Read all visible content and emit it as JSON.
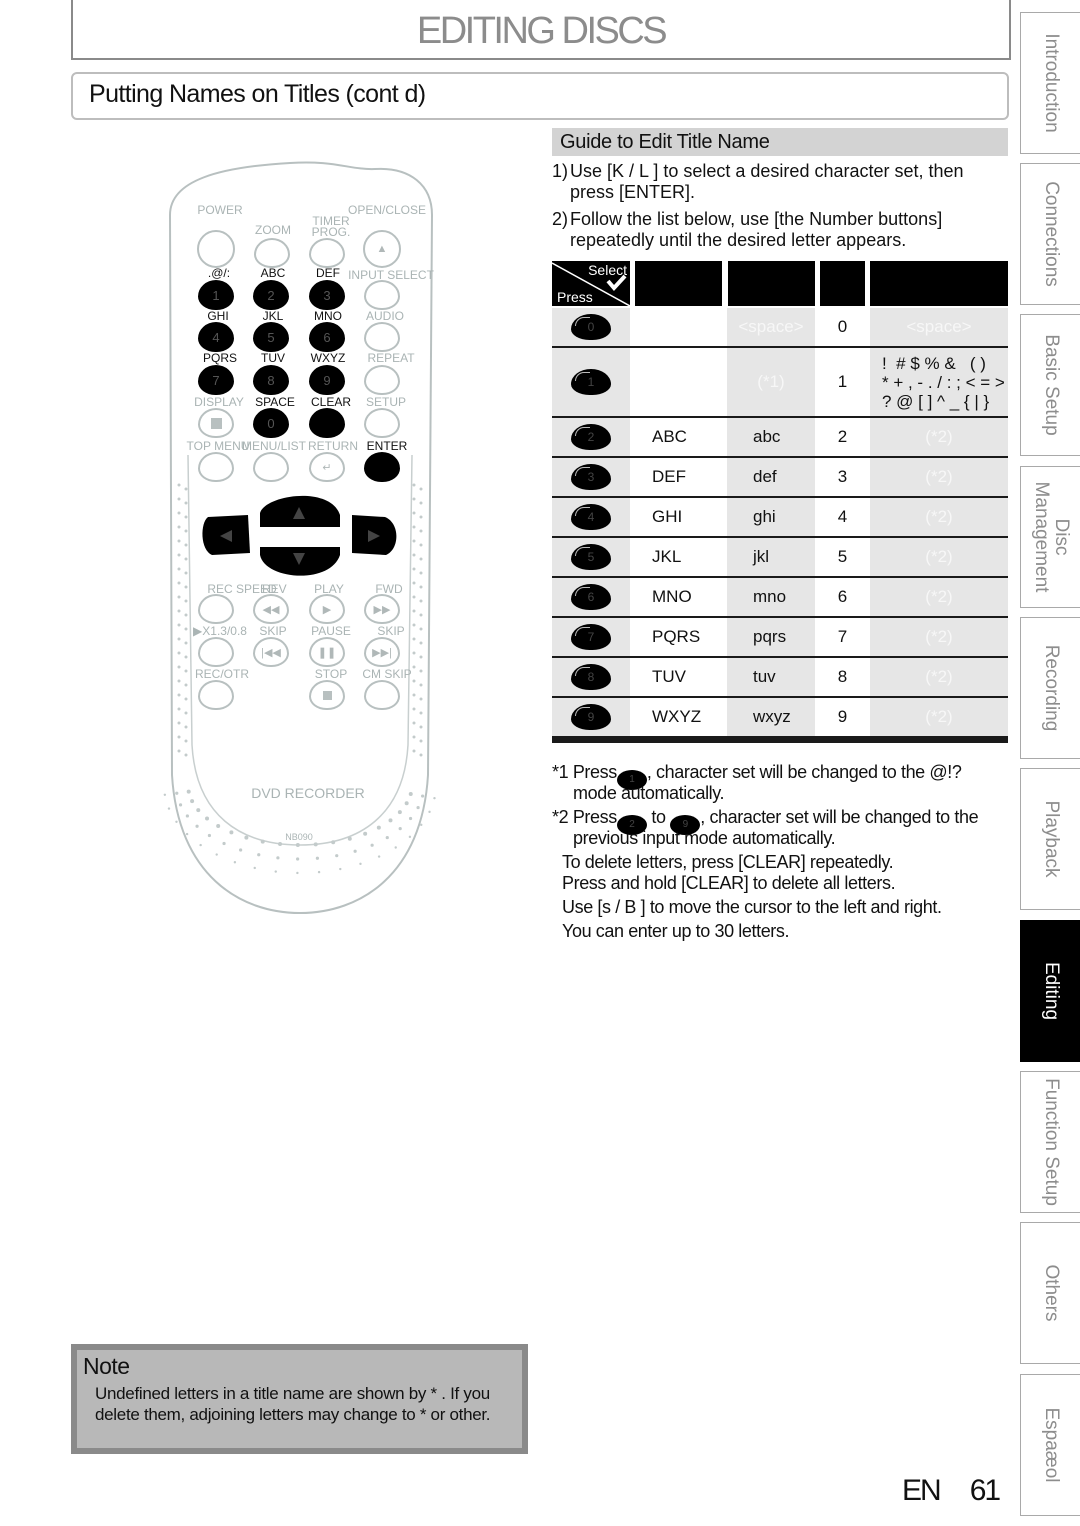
{
  "header": {
    "title": "EDITING DISCS",
    "subtitle": "Putting Names on Titles (cont d)"
  },
  "side_tabs": [
    {
      "label": "Introduction",
      "active": false
    },
    {
      "label": "Connections",
      "active": false
    },
    {
      "label": "Basic Setup",
      "active": false
    },
    {
      "label": "Disc\nManagement",
      "label_line1": "Disc",
      "label_line2": "Management",
      "active": false
    },
    {
      "label": "Recording",
      "active": false
    },
    {
      "label": "Playback",
      "active": false
    },
    {
      "label": "Editing",
      "active": true
    },
    {
      "label": "Function Setup",
      "active": false
    },
    {
      "label": "Others",
      "active": false
    },
    {
      "label": "Espaæol",
      "active": false
    }
  ],
  "guide": {
    "heading": "Guide to Edit Title Name",
    "steps": [
      {
        "num": "1)",
        "text": "Use [K / L ] to select a desired character set, then press [ENTER]."
      },
      {
        "num": "2)",
        "text": "Follow the list below, use [the Number buttons] repeatedly until the desired letter appears."
      }
    ]
  },
  "char_table": {
    "corner_select": "Select",
    "corner_press": "Press",
    "rows": [
      {
        "button": "0",
        "upper": "",
        "lower": "<space>",
        "number": "0",
        "symbol": "<space>"
      },
      {
        "button": "1",
        "upper": "",
        "lower": "(*1)",
        "number": "1",
        "symbol": "!  # $ % &   ( )\n* + , - . / : ; < = >\n? @ [ ] ^ _ { | }"
      },
      {
        "button": "2",
        "upper": "ABC",
        "lower": "abc",
        "number": "2",
        "symbol": "(*2)"
      },
      {
        "button": "3",
        "upper": "DEF",
        "lower": "def",
        "number": "3",
        "symbol": "(*2)"
      },
      {
        "button": "4",
        "upper": "GHI",
        "lower": "ghi",
        "number": "4",
        "symbol": "(*2)"
      },
      {
        "button": "5",
        "upper": "JKL",
        "lower": "jkl",
        "number": "5",
        "symbol": "(*2)"
      },
      {
        "button": "6",
        "upper": "MNO",
        "lower": "mno",
        "number": "6",
        "symbol": "(*2)"
      },
      {
        "button": "7",
        "upper": "PQRS",
        "lower": "pqrs",
        "number": "7",
        "symbol": "(*2)"
      },
      {
        "button": "8",
        "upper": "TUV",
        "lower": "tuv",
        "number": "8",
        "symbol": "(*2)"
      },
      {
        "button": "9",
        "upper": "WXYZ",
        "lower": "wxyz",
        "number": "9",
        "symbol": "(*2)"
      }
    ]
  },
  "footnotes": {
    "fn1_a": "*1 Press",
    "fn1_btn": "1",
    "fn1_b": ", character set will be changed to the   @!?",
    "fn1_c": "mode automatically.",
    "fn2_a": "*2 Press",
    "fn2_btn1": "2",
    "fn2_to": " to ",
    "fn2_btn2": "9",
    "fn2_b": ", character set will be changed to the",
    "fn2_c": "previous input mode automatically.",
    "tips": [
      "To delete letters, press [CLEAR] repeatedly.",
      "Press and hold [CLEAR] to delete all letters.",
      "Use [s   / B ] to move the cursor to the left and right.",
      "You can enter up to 30 letters."
    ]
  },
  "remote": {
    "labels": {
      "power": "POWER",
      "zoom": "ZOOM",
      "timer": "TIMER",
      "prog": "PROG.",
      "open_close": "OPEN/CLOSE",
      "k1": ".@/:",
      "k2": "ABC",
      "k3": "DEF",
      "input_select": "INPUT SELECT",
      "k4": "GHI",
      "k5": "JKL",
      "k6": "MNO",
      "audio": "AUDIO",
      "k7": "PQRS",
      "k8": "TUV",
      "k9": "WXYZ",
      "repeat": "REPEAT",
      "display": "DISPLAY",
      "space": "SPACE",
      "clear": "CLEAR",
      "setup": "SETUP",
      "top_menu": "TOP MENU",
      "menu_list": "MENU/LIST",
      "return": "RETURN",
      "enter": "ENTER",
      "rec_speed": "REC SPEED",
      "rev": "REV",
      "play": "PLAY",
      "fwd": "FWD",
      "x13": "▶X1.3/0.8",
      "skip_back": "SKIP",
      "pause": "PAUSE",
      "skip_fwd": "SKIP",
      "rec_otr": "REC/OTR",
      "stop": "STOP",
      "cm_skip": "CM SKIP",
      "brand": "DVD RECORDER",
      "model": "NB090"
    },
    "digits": [
      "1",
      "2",
      "3",
      "4",
      "5",
      "6",
      "7",
      "8",
      "9",
      "0"
    ]
  },
  "note": {
    "title": "Note",
    "text": "Undefined letters in a title name are shown by  * . If you delete them, adjoining letters may change to  *  or other."
  },
  "footer": {
    "lang": "EN",
    "page": "61"
  }
}
